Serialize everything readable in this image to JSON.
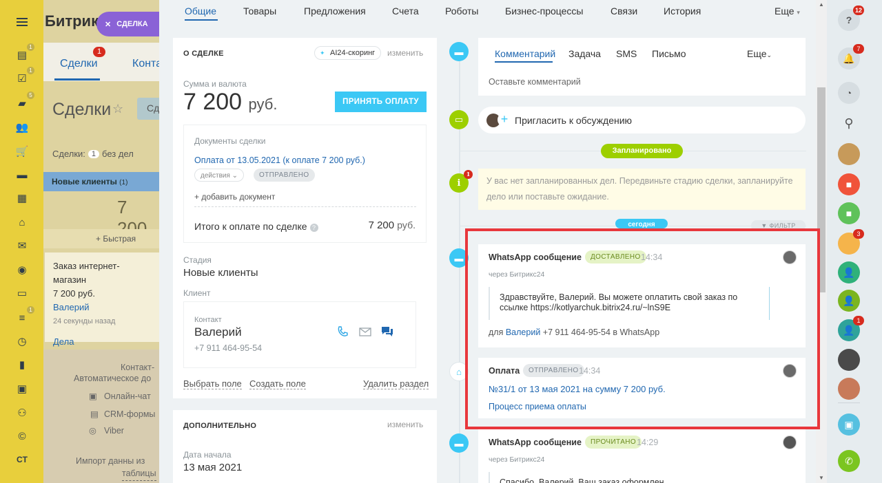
{
  "bg": {
    "logo": "Битрик",
    "deal_btn": "СДЕЛКА",
    "tab_deals": "Сделки",
    "tab_deals_badge": "1",
    "tab_contacts": "Конта",
    "title": "Сделки",
    "filter_btn": "Сд",
    "counter_label": "Сделки:",
    "counter_value": "1",
    "counter_suffix": "без дел",
    "stage_name": "Новые клиенты",
    "stage_count": "(1)",
    "stage_sum": "7 200",
    "quick_add": "+ Быстрая",
    "card_title": "Заказ интернет-магазин",
    "card_sum": "7 200 руб.",
    "card_client": "Валерий",
    "card_time": "24 секунды назад",
    "card_tasks": "Дела",
    "empty_line1": "Контакт-",
    "empty_line2": "Автоматическое до",
    "empty_chat": "Онлайн-чат",
    "empty_forms": "CRM-формы",
    "empty_viber": "Viber",
    "empty_import": "Импорт данны из",
    "empty_table": "таблицы"
  },
  "nav": {
    "badges": [
      "1",
      "1",
      "5",
      "1"
    ]
  },
  "top_tabs": [
    "Общие",
    "Товары",
    "Предложения",
    "Счета",
    "Роботы",
    "Бизнес-процессы",
    "Связи",
    "История",
    "Еще"
  ],
  "about": {
    "heading": "О СДЕЛКЕ",
    "ai_chip": "AI24-скоринг",
    "change": "изменить",
    "sum_label": "Сумма и валюта",
    "sum_value": "7 200",
    "sum_currency": "руб.",
    "accept_btn": "ПРИНЯТЬ ОПЛАТУ",
    "docs_label": "Документы сделки",
    "doc_link": "Оплата от 13.05.2021 (к оплате 7 200 руб.)",
    "doc_actions": "действия",
    "doc_status": "ОТПРАВЛЕНО",
    "add_doc": "+ добавить документ",
    "total_label": "Итого к оплате по сделке",
    "total_value": "7 200",
    "total_currency": "руб.",
    "stage_label": "Стадия",
    "stage_value": "Новые клиенты",
    "client_label": "Клиент",
    "contact_label": "Контакт",
    "contact_name": "Валерий",
    "contact_phone": "+7 911 464-95-54",
    "select_field": "Выбрать поле",
    "create_field": "Создать поле",
    "delete_section": "Удалить раздел"
  },
  "extra": {
    "heading": "ДОПОЛНИТЕЛЬНО",
    "change": "изменить",
    "start_label": "Дата начала",
    "start_value": "13 мая 2021"
  },
  "editor": {
    "tabs": [
      "Комментарий",
      "Задача",
      "SMS",
      "Письмо",
      "Еще"
    ],
    "placeholder": "Оставьте комментарий"
  },
  "invite": "Пригласить к обсуждению",
  "planned_pill": "Запланировано",
  "no_plans": "У вас нет запланированных дел. Передвиньте стадию сделки, запланируйте дело или поставьте ожидание.",
  "today_pill": "сегодня",
  "filter": "ФИЛЬТР",
  "wa1": {
    "title": "WhatsApp сообщение",
    "status": "ДОСТАВЛЕНО",
    "time": "14:34",
    "via": "через Битрикс24",
    "text": "Здравствуйте, Валерий. Вы можете оплатить свой заказ по ссылке https://kotlyarchuk.bitrix24.ru/~lnS9E",
    "for_prefix": "для",
    "for_name": "Валерий",
    "for_rest": "+7 911 464-95-54 в WhatsApp"
  },
  "pay": {
    "title": "Оплата",
    "status": "ОТПРАВЛЕНО",
    "time": "14:34",
    "link": "№31/1 от 13 мая 2021 на сумму 7 200 руб.",
    "process": "Процесс приема оплаты"
  },
  "wa2": {
    "title": "WhatsApp сообщение",
    "status": "ПРОЧИТАНО",
    "time": "14:29",
    "via": "через Битрикс24",
    "text_partial": "Спасибо, Валерий. Ваш заказ оформлен"
  },
  "right_bar": {
    "help_badge": "12",
    "bell_badge": "7",
    "avatar_badge": "3",
    "contact_badge": "1"
  },
  "colors": {
    "accent": "#2067b0",
    "highlight": "#e8373c",
    "btn": "#3bc8f5",
    "green": "#9dcf00"
  }
}
